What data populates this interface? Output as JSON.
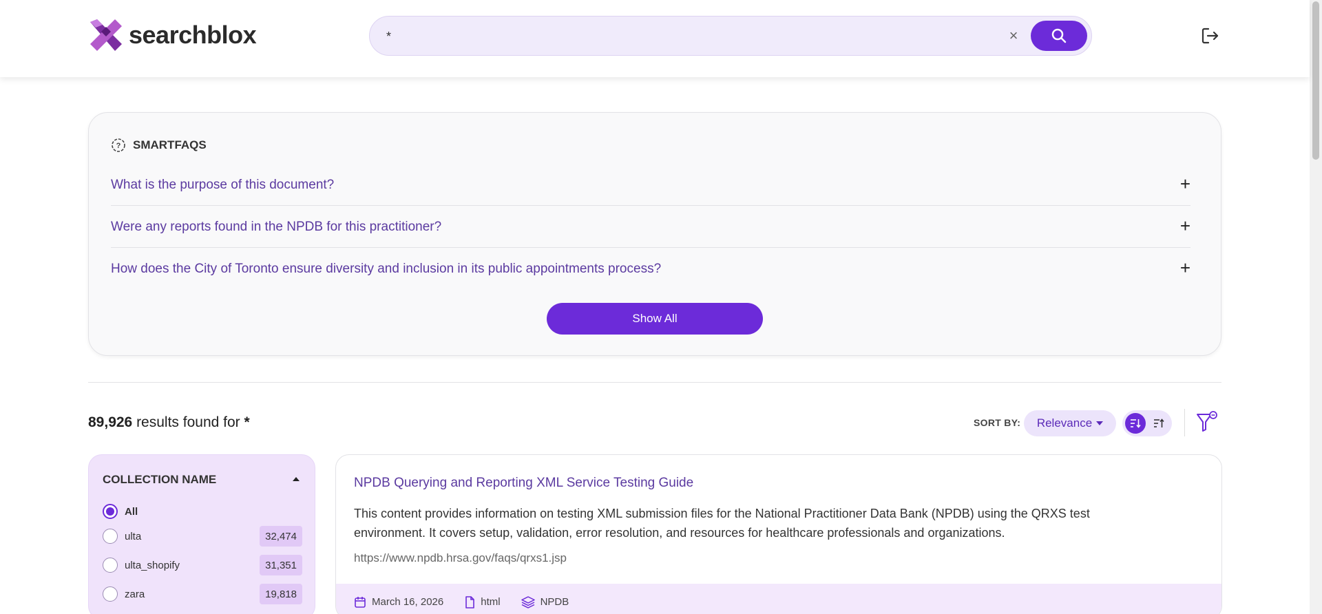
{
  "header": {
    "logo_text": "searchblox",
    "search_value": "*",
    "clear_glyph": "×",
    "search_button_icon": "search-icon",
    "logout_icon": "logout-icon"
  },
  "smartfaqs": {
    "title": "SMARTFAQS",
    "icon": "question-circle-icon",
    "questions": [
      "What is the purpose of this document?",
      "Were any reports found in the NPDB for this practitioner?",
      "How does the City of Toronto ensure diversity and inclusion in its public appointments process?"
    ],
    "expand_glyph": "+",
    "show_all_label": "Show All"
  },
  "results": {
    "count": "89,926",
    "found_text": " results found for ",
    "query": "*",
    "sort_by_label": "SORT BY:",
    "sort_value": "Relevance"
  },
  "facet": {
    "title": "COLLECTION NAME",
    "items": [
      {
        "label": "All",
        "count": "",
        "selected": true
      },
      {
        "label": "ulta",
        "count": "32,474",
        "selected": false
      },
      {
        "label": "ulta_shopify",
        "count": "31,351",
        "selected": false
      },
      {
        "label": "zara",
        "count": "19,818",
        "selected": false
      }
    ]
  },
  "result_items": [
    {
      "title": "NPDB Querying and Reporting XML Service Testing Guide",
      "description": "This content provides information on testing XML submission files for the National Practitioner Data Bank (NPDB) using the QRXS test environment. It covers setup, validation, error resolution, and resources for healthcare professionals and organizations.",
      "url": "https://www.npdb.hrsa.gov/faqs/qrxs1.jsp",
      "date": "March 16, 2026",
      "type": "html",
      "collection": "NPDB"
    }
  ],
  "colors": {
    "accent": "#6c2bd9",
    "link": "#5b3aa0",
    "facet_bg": "#f0e3fb"
  }
}
